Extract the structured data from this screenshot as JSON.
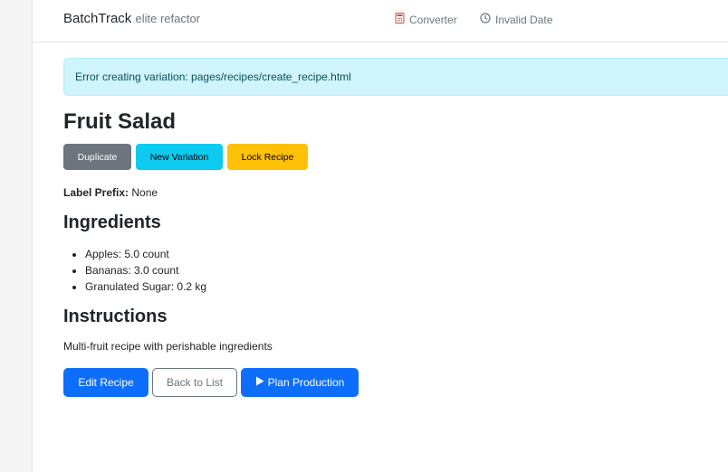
{
  "header": {
    "brand": "BatchTrack",
    "brand_sub": "elite refactor",
    "nav": [
      {
        "label": "Converter",
        "icon": "calculator-icon"
      },
      {
        "label": "Invalid Date",
        "icon": "clock-icon"
      }
    ]
  },
  "alert": {
    "message": "Error creating variation: pages/recipes/create_recipe.html"
  },
  "recipe": {
    "title": "Fruit Salad",
    "actions": {
      "duplicate": "Duplicate",
      "new_variation": "New Variation",
      "lock": "Lock Recipe"
    },
    "label_prefix_label": "Label Prefix:",
    "label_prefix_value": "None",
    "ingredients_heading": "Ingredients",
    "ingredients": [
      "Apples: 5.0 count",
      "Bananas: 3.0 count",
      "Granulated Sugar: 0.2 kg"
    ],
    "instructions_heading": "Instructions",
    "instructions": "Multi-fruit recipe with perishable ingredients"
  },
  "footer_actions": {
    "edit": "Edit Recipe",
    "back": "Back to List",
    "plan": "Plan Production"
  },
  "colors": {
    "primary": "#0d6efd",
    "info": "#0dcaf0",
    "warning": "#ffc107",
    "secondary": "#6c757d",
    "alert_bg": "#cff4fc"
  }
}
